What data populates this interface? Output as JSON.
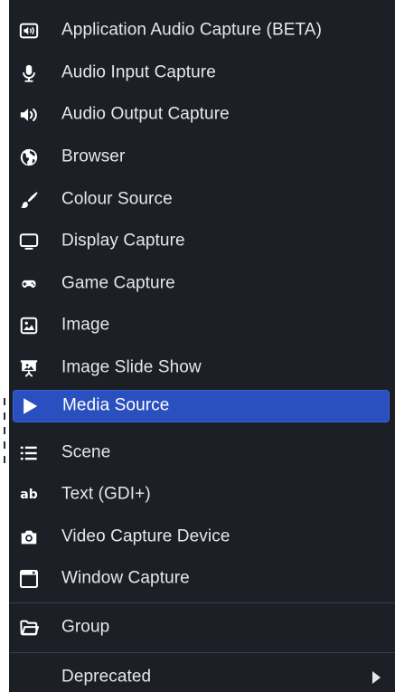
{
  "menu": {
    "items": [
      {
        "label": "Application Audio Capture (BETA)",
        "icon": "app-audio-icon"
      },
      {
        "label": "Audio Input Capture",
        "icon": "microphone-icon"
      },
      {
        "label": "Audio Output Capture",
        "icon": "speaker-icon"
      },
      {
        "label": "Browser",
        "icon": "globe-icon"
      },
      {
        "label": "Colour Source",
        "icon": "paintbrush-icon"
      },
      {
        "label": "Display Capture",
        "icon": "monitor-icon"
      },
      {
        "label": "Game Capture",
        "icon": "gamepad-icon"
      },
      {
        "label": "Image",
        "icon": "image-icon"
      },
      {
        "label": "Image Slide Show",
        "icon": "slideshow-icon"
      },
      {
        "label": "Media Source",
        "icon": "play-icon",
        "selected": true
      },
      {
        "label": "Scene",
        "icon": "list-icon"
      },
      {
        "label": "Text (GDI+)",
        "icon": "text-icon",
        "icon_text": "ab"
      },
      {
        "label": "Video Capture Device",
        "icon": "camera-icon"
      },
      {
        "label": "Window Capture",
        "icon": "window-icon"
      },
      {
        "label": "Group",
        "icon": "folder-icon"
      },
      {
        "label": "Deprecated",
        "icon": "",
        "has_submenu": true
      }
    ]
  },
  "colors": {
    "background": "#1d1f26",
    "selected": "#2a4fbe",
    "text": "#e6e7ea",
    "separator": "#3a3d46"
  }
}
